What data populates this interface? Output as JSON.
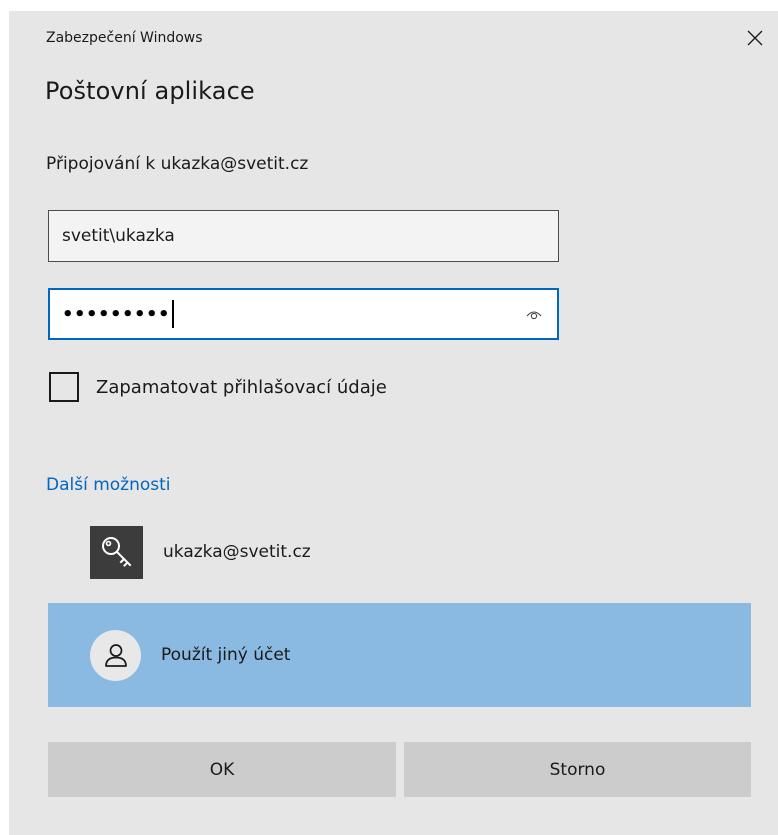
{
  "window": {
    "caption": "Zabezpečení Windows",
    "close_icon": "close-icon"
  },
  "dialog": {
    "title": "Poštovní aplikace",
    "subtitle": "Připojování k ukazka@svetit.cz"
  },
  "form": {
    "username_value": "svetit\\ukazka",
    "password_mask": "•••••••••",
    "reveal_icon": "eye-icon",
    "remember_label": "Zapamatovat přihlašovací údaje",
    "remember_checked": false
  },
  "more_options": {
    "label": "Další možnosti",
    "accounts": [
      {
        "label": "ukazka@svetit.cz",
        "icon": "key-icon",
        "selected": false
      },
      {
        "label": "Použít jiný účet",
        "icon": "person-icon",
        "selected": true
      }
    ]
  },
  "buttons": {
    "ok_label": "OK",
    "cancel_label": "Storno"
  },
  "colors": {
    "dialog_bg": "#e6e6e6",
    "accent": "#0067c0",
    "selected_row": "#8ab9e1",
    "button_bg": "#cccccc"
  }
}
